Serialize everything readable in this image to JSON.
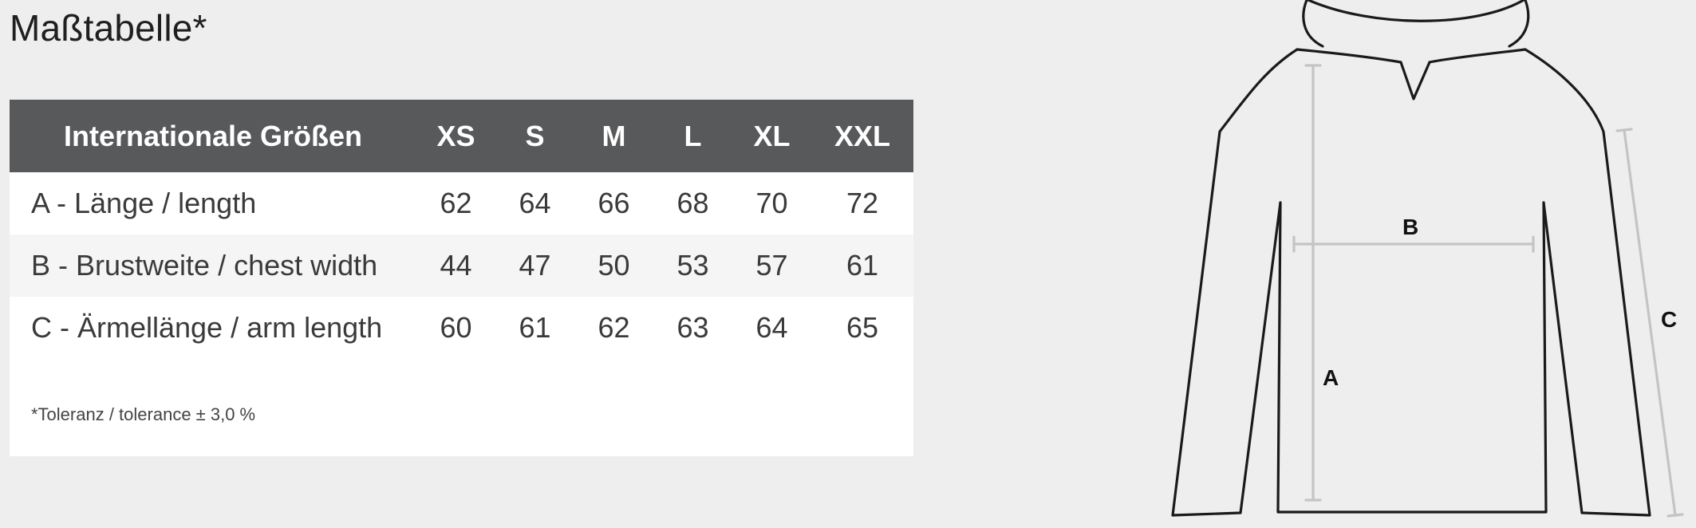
{
  "title": "Maßtabelle*",
  "table": {
    "header_label": "Internationale Größen",
    "sizes": [
      "XS",
      "S",
      "M",
      "L",
      "XL",
      "XXL"
    ],
    "rows": [
      {
        "label": "A - Länge / length",
        "values": [
          "62",
          "64",
          "66",
          "68",
          "70",
          "72"
        ]
      },
      {
        "label": "B - Brustweite / chest width",
        "values": [
          "44",
          "47",
          "50",
          "53",
          "57",
          "61"
        ]
      },
      {
        "label": "C - Ärmellänge / arm length",
        "values": [
          "60",
          "61",
          "62",
          "63",
          "64",
          "65"
        ]
      }
    ],
    "footnote": "*Toleranz / tolerance ± 3,0 %"
  },
  "diagram": {
    "labels": {
      "a": "A",
      "b": "B",
      "c": "C"
    }
  },
  "colors": {
    "header_bg": "#58595b",
    "page_bg": "#eeeeee",
    "row_alt": "#f5f5f5",
    "row": "#ffffff"
  }
}
